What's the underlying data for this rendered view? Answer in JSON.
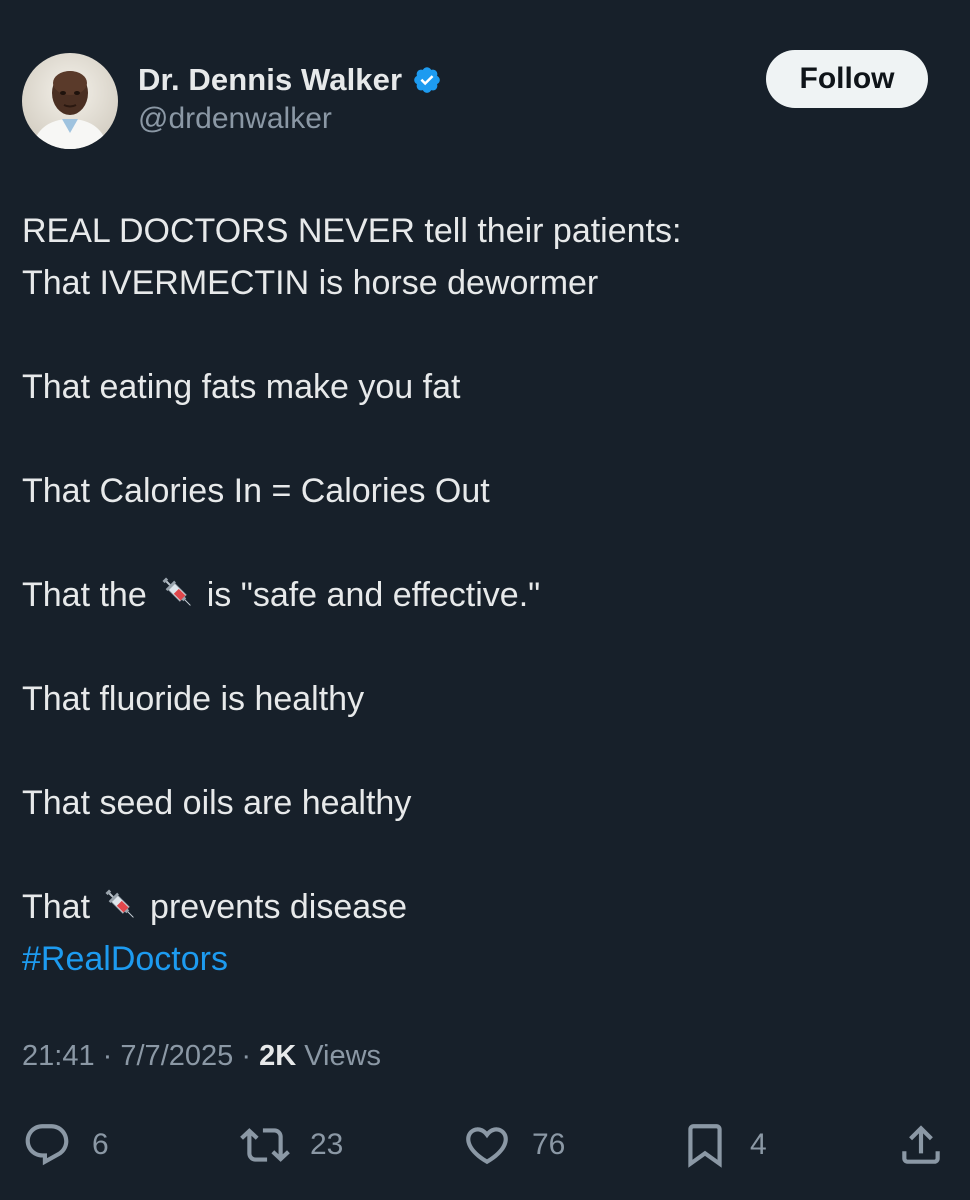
{
  "author": {
    "display_name": "Dr. Dennis Walker",
    "handle": "@drdenwalker",
    "verified": true,
    "verified_color": "#1d9bf0"
  },
  "follow_label": "Follow",
  "tweet": {
    "line1": "REAL DOCTORS NEVER tell their patients:",
    "line2": "That IVERMECTIN is horse dewormer",
    "line3": "That eating fats make you fat",
    "line4": "That Calories In = Calories Out",
    "line5_prefix": "That the",
    "line5_suffix": "is \"safe and effective.\"",
    "line6": "That fluoride is healthy",
    "line7": "That seed oils are healthy",
    "line8_prefix": "That",
    "line8_suffix": "prevents disease",
    "hashtag": "#RealDoctors",
    "emoji_icon": "syringe-icon"
  },
  "meta": {
    "time": "21:41",
    "separator": "·",
    "date": "7/7/2025",
    "views_count": "2K",
    "views_label": "Views"
  },
  "actions": {
    "replies": "6",
    "reposts": "23",
    "likes": "76",
    "bookmarks": "4"
  },
  "colors": {
    "background": "#17202a",
    "text": "#e7e9ea",
    "secondary": "#8b98a5",
    "link": "#1d9bf0"
  }
}
